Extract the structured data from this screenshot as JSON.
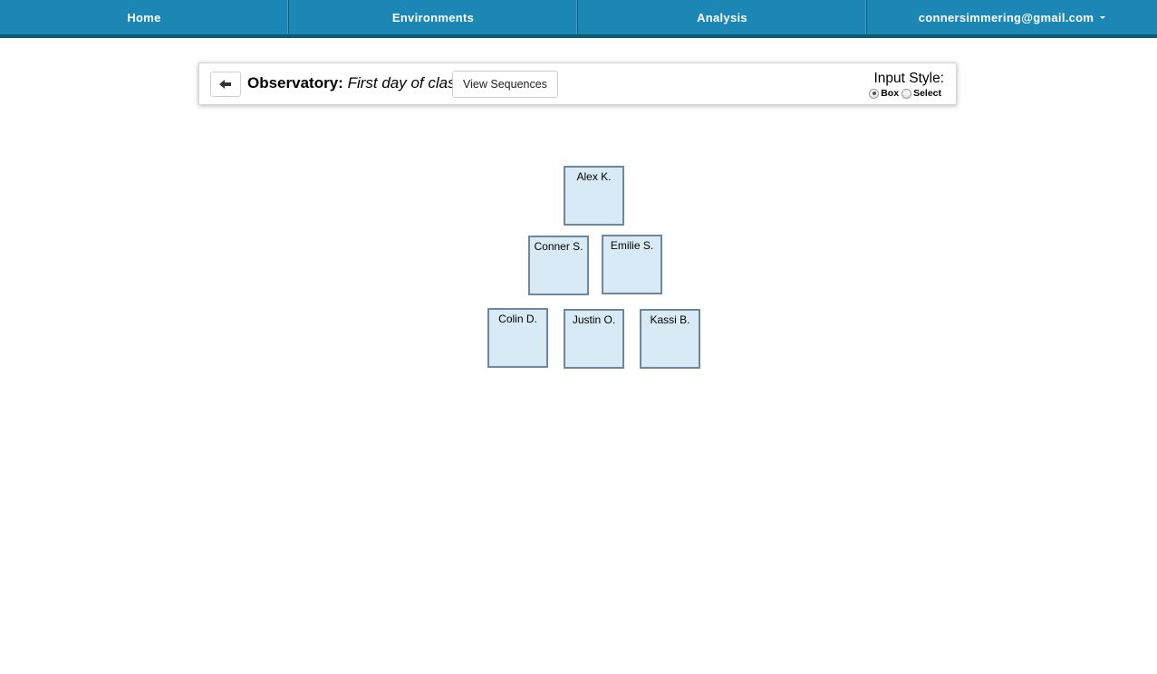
{
  "nav": {
    "items": [
      {
        "label": "Home"
      },
      {
        "label": "Environments"
      },
      {
        "label": "Analysis"
      },
      {
        "label": "connersimmering@gmail.com"
      }
    ]
  },
  "toolbar": {
    "title_label": "Observatory:",
    "title_name": "First day of class",
    "view_sequences_label": "View Sequences",
    "input_style_label": "Input Style:",
    "input_style_options": [
      {
        "label": "Box",
        "selected": true
      },
      {
        "label": "Select",
        "selected": false
      }
    ]
  },
  "seats": [
    {
      "name": "Alex K."
    },
    {
      "name": "Conner S."
    },
    {
      "name": "Emilie S."
    },
    {
      "name": "Colin D."
    },
    {
      "name": "Justin O."
    },
    {
      "name": "Kassi B."
    }
  ],
  "colors": {
    "navbar": "#1c87b5",
    "navbar_border": "#0f5874",
    "seat_fill": "#d8eaf5",
    "seat_border": "#6f879a"
  }
}
